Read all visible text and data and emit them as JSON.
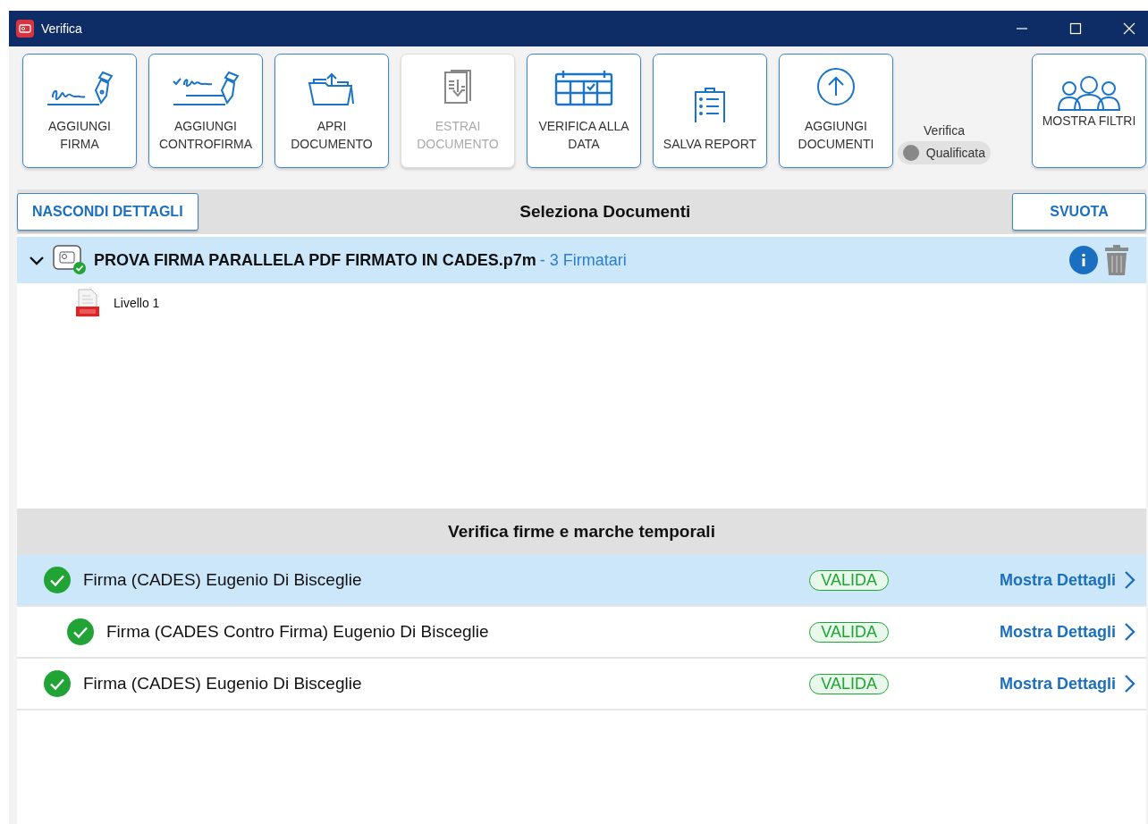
{
  "window": {
    "title": "Verifica"
  },
  "toolbar": {
    "buttons": [
      {
        "label": "AGGIUNGI FIRMA",
        "disabled": false
      },
      {
        "label": "AGGIUNGI CONTROFIRMA",
        "disabled": false
      },
      {
        "label": "APRI DOCUMENTO",
        "disabled": false
      },
      {
        "label": "ESTRAI DOCUMENTO",
        "disabled": true
      },
      {
        "label": "VERIFICA ALLA DATA",
        "disabled": false
      },
      {
        "label": "SALVA REPORT",
        "disabled": false
      },
      {
        "label": "AGGIUNGI DOCUMENTI",
        "disabled": false
      }
    ],
    "toggle": {
      "caption": "Verifica",
      "label": "Qualificata",
      "on": false
    },
    "filter_button": {
      "label": "MOSTRA FILTRI"
    }
  },
  "documents": {
    "title": "Seleziona Documenti",
    "hide_button": "NASCONDI DETTAGLI",
    "clear_button": "SVUOTA",
    "items": [
      {
        "name": "PROVA FIRMA PARALLELA PDF FIRMATO IN CADES.p7m",
        "signers": "- 3 Firmatari",
        "expanded": true,
        "selected": true,
        "children": [
          {
            "name": "Livello 1"
          }
        ]
      }
    ]
  },
  "signatures": {
    "title": "Verifica firme e marche temporali",
    "rows": [
      {
        "label": "Firma (CADES) Eugenio Di Bisceglie",
        "status": "VALIDA",
        "link": "Mostra Dettagli",
        "selected": true,
        "children": [
          {
            "label": "Firma (CADES Contro Firma) Eugenio Di Bisceglie",
            "status": "VALIDA",
            "link": "Mostra Dettagli",
            "selected": false
          }
        ]
      },
      {
        "label": "Firma (CADES) Eugenio Di Bisceglie",
        "status": "VALIDA",
        "link": "Mostra Dettagli",
        "selected": false
      }
    ]
  }
}
